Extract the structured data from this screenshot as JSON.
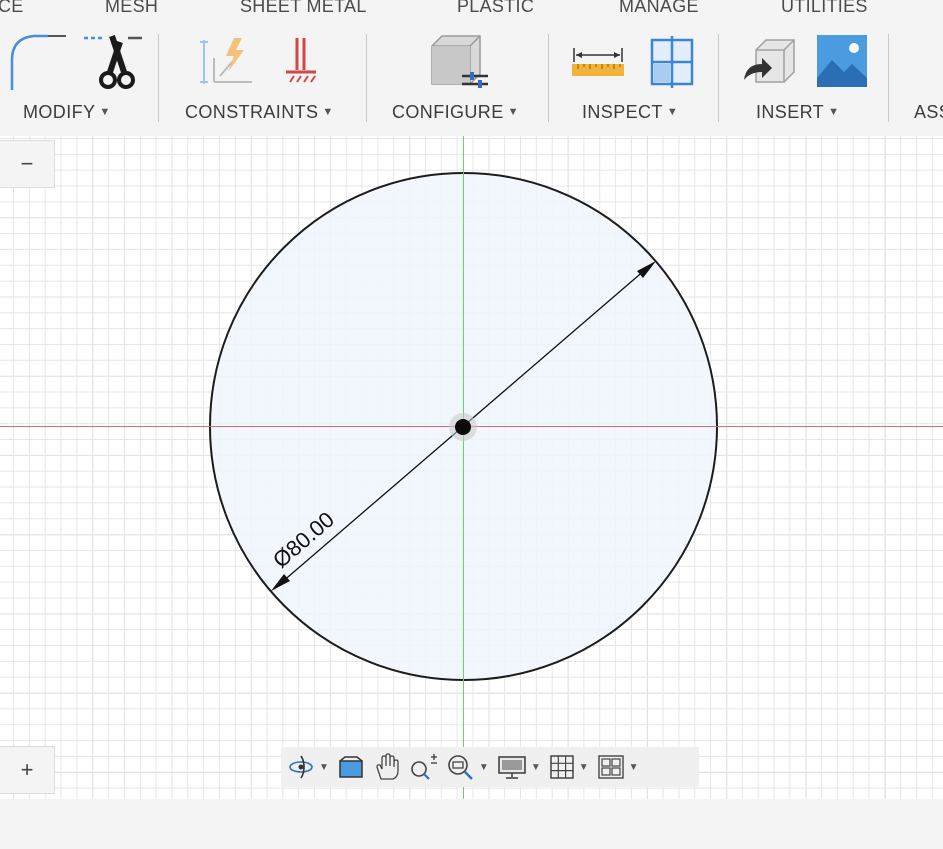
{
  "tabs": [
    "CE",
    "MESH",
    "SHEET METAL",
    "PLASTIC",
    "MANAGE",
    "UTILITIES"
  ],
  "toolbar": {
    "groups": [
      "MODIFY",
      "CONSTRAINTS",
      "CONFIGURE",
      "INSPECT",
      "INSERT",
      "ASS"
    ],
    "tools": {
      "modify": [
        "fillet-icon",
        "trim-scissors-icon"
      ],
      "constraints": [
        "sketch-constraints-icon",
        "fix-constraint-icon"
      ],
      "configure": [
        "configure-parameters-icon"
      ],
      "inspect": [
        "measure-ruler-icon",
        "section-analysis-icon"
      ],
      "insert": [
        "insert-derive-icon",
        "insert-canvas-image-icon"
      ]
    }
  },
  "sketch": {
    "dimension_label": "Ø80.00",
    "diameter": 80.0,
    "circle_fill": "#eef6fd",
    "x_axis_color": "#d2726f",
    "y_axis_color": "#5ddb5d"
  },
  "viewport_controls": {
    "zoom_out_label": "−",
    "zoom_in_label": "+"
  },
  "navbar": {
    "tools": [
      "orbit-icon",
      "look-at-icon",
      "pan-hand-icon",
      "zoom-icon",
      "fit-window-icon",
      "display-settings-icon",
      "grid-snaps-icon",
      "viewports-icon"
    ]
  }
}
